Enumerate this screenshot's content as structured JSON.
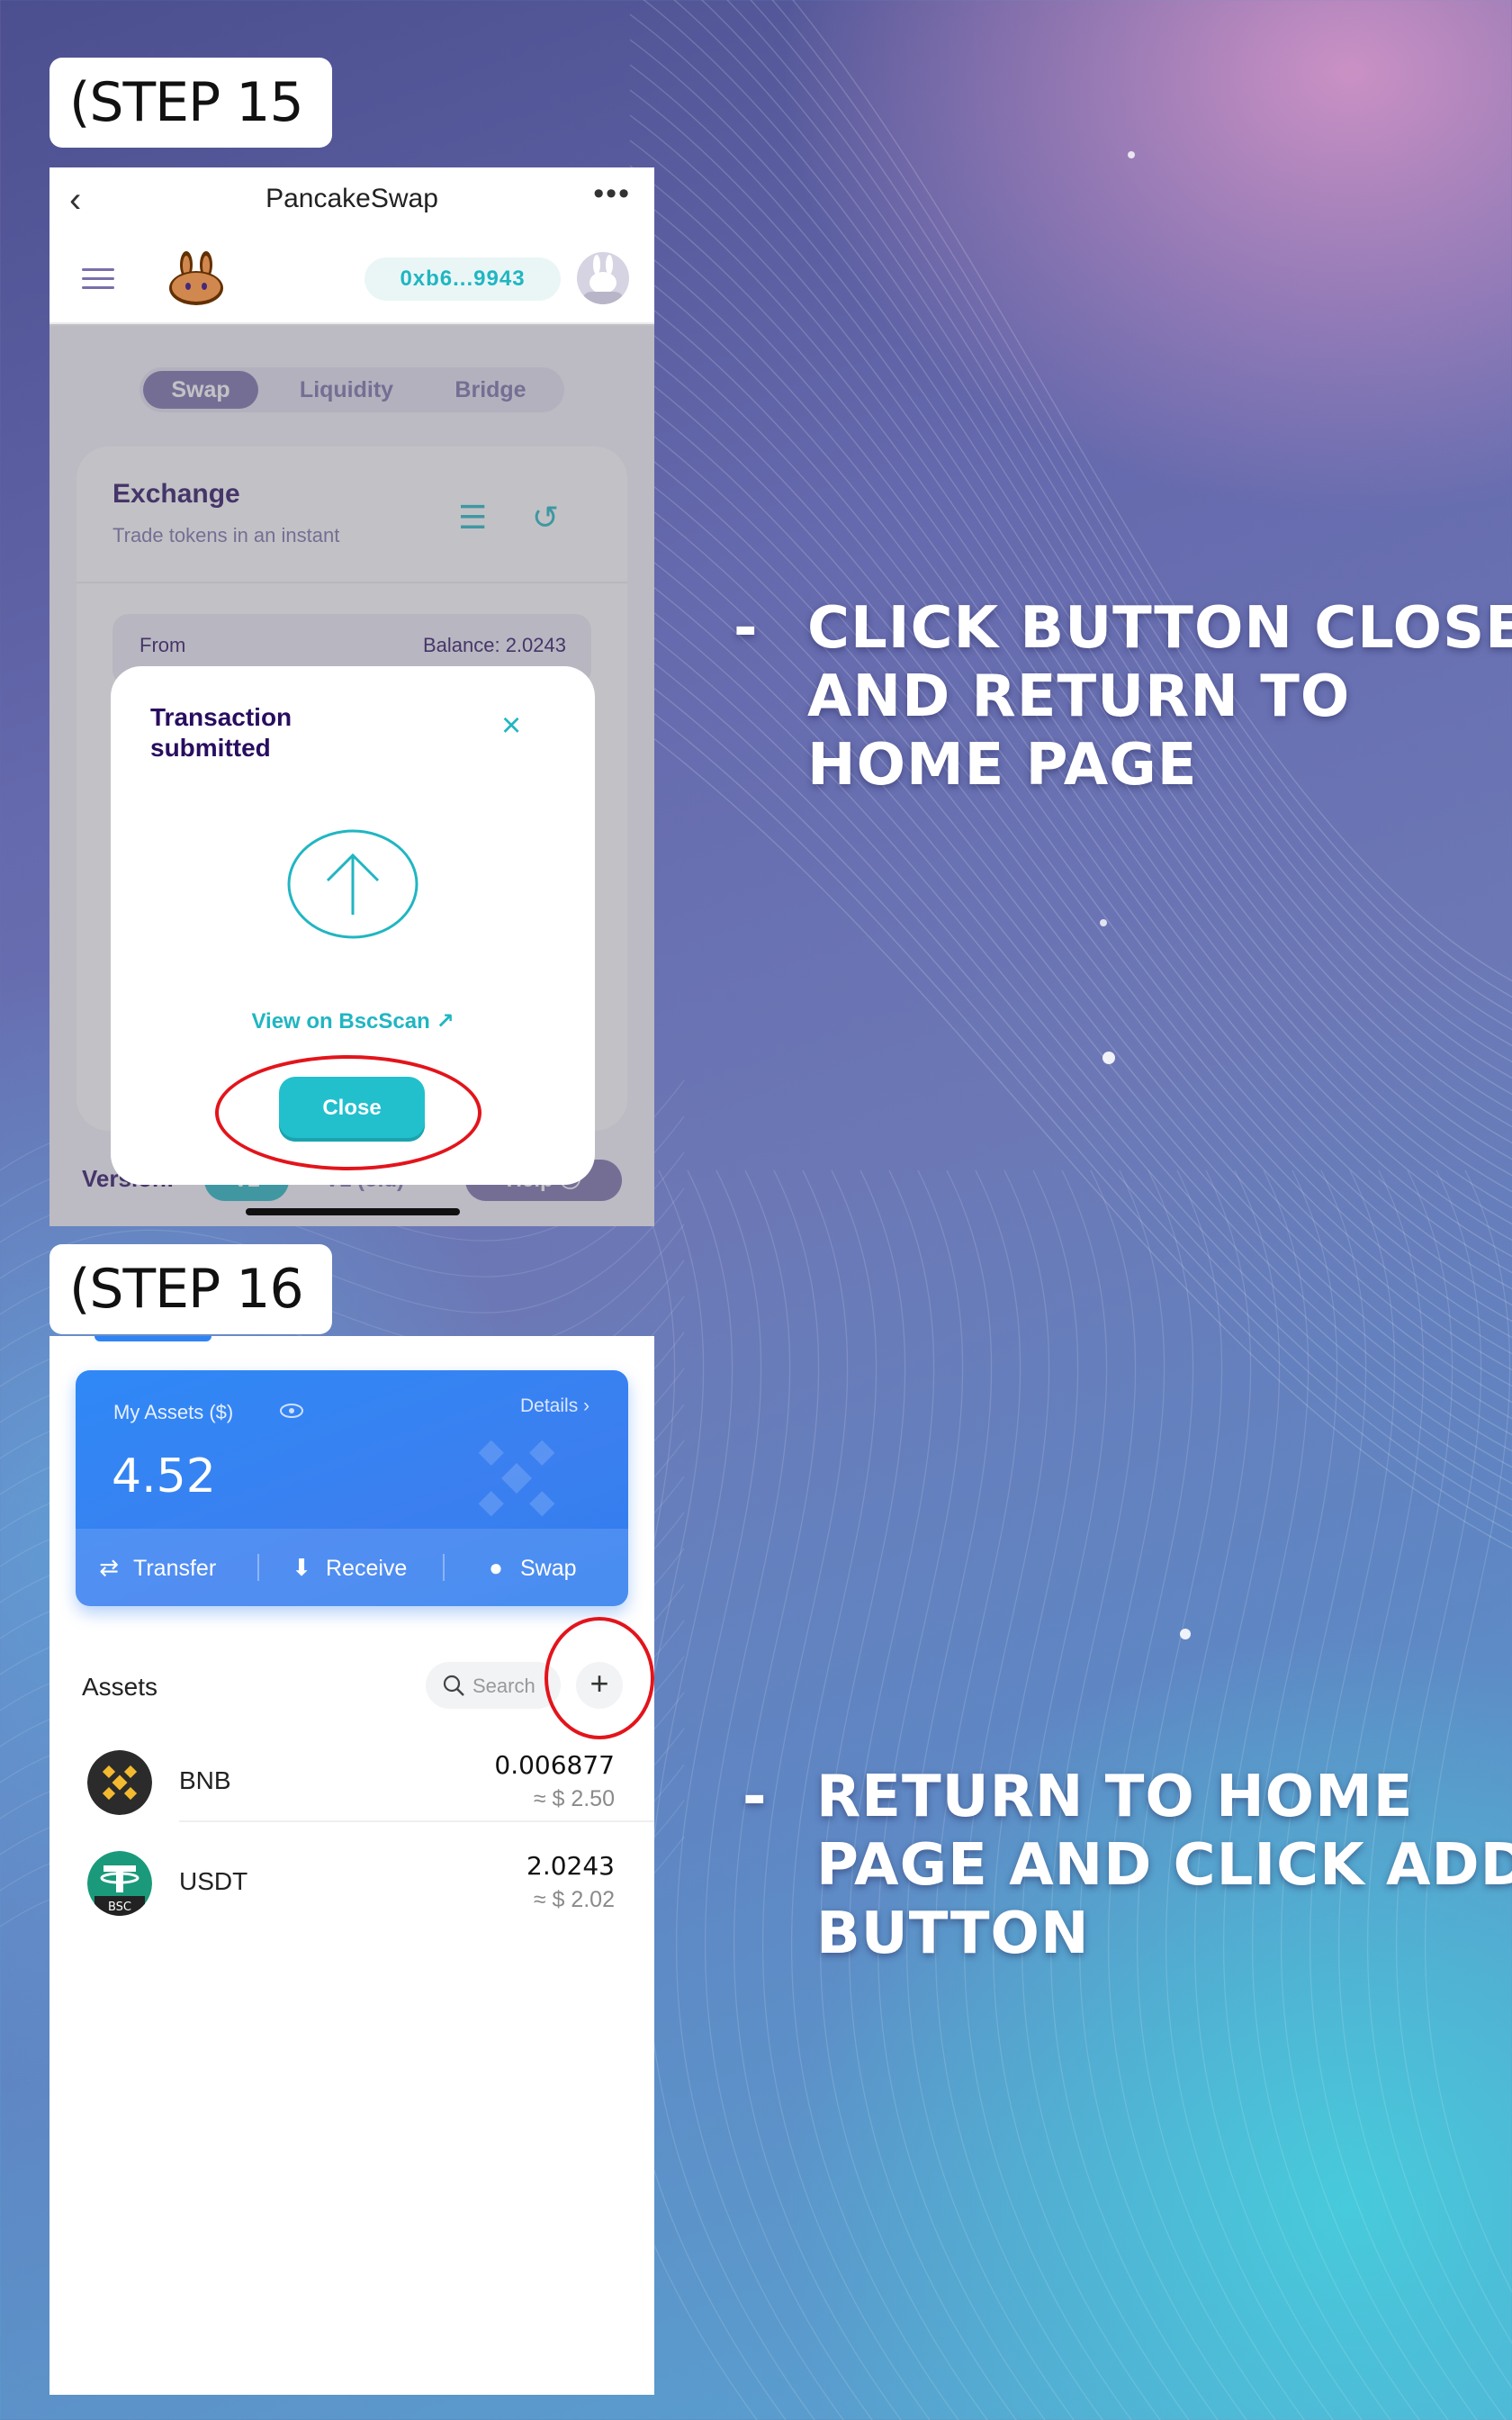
{
  "steps": {
    "step15_label": "(STEP 15 )",
    "step16_label": "(STEP 16 )"
  },
  "instructions": {
    "first": {
      "dash": "-",
      "text": "CLICK BUTTON CLOSE AND RETURN TO HOME PAGE"
    },
    "second": {
      "dash": "-",
      "text": "RETURN TO HOME PAGE AND CLICK ADD BUTTON"
    }
  },
  "pancake": {
    "title": "PancakeSwap",
    "back_icon": "chevron-left-icon",
    "more_icon": "more-dots-icon",
    "wallet_address": "0xb6...9943",
    "tabs": [
      {
        "label": "Swap",
        "active": true
      },
      {
        "label": "Liquidity",
        "active": false
      },
      {
        "label": "Bridge",
        "active": false
      }
    ],
    "exchange_title": "Exchange",
    "exchange_subtitle": "Trade tokens in an instant",
    "from_label": "From",
    "balance_label": "Balance: 2.0243",
    "version_label": "Version:",
    "version_v2": "V2",
    "version_v1": "V1 (old)",
    "help_label": "Help",
    "modal": {
      "title": "Transaction submitted",
      "close_x": "×",
      "bscscan_link": "View on BscScan",
      "close_button": "Close"
    },
    "accent_color": "#20b6c2"
  },
  "wallet": {
    "my_assets_label": "My Assets  ($)",
    "details_label": "Details",
    "total_value": "4.52",
    "actions": [
      {
        "label": "Transfer",
        "icon": "transfer-icon"
      },
      {
        "label": "Receive",
        "icon": "download-icon"
      },
      {
        "label": "Swap",
        "icon": "swap-icon"
      }
    ],
    "assets_heading": "Assets",
    "search_placeholder": "Search",
    "add_symbol": "+",
    "assets": [
      {
        "symbol": "BNB",
        "amount": "0.006877",
        "usd": "≈ $ 2.50",
        "icon": "bnb-logo"
      },
      {
        "symbol": "USDT",
        "amount": "2.0243",
        "usd": "≈ $ 2.02",
        "icon": "usdt-bsc-logo"
      }
    ],
    "card_color": "#2f88f6"
  }
}
